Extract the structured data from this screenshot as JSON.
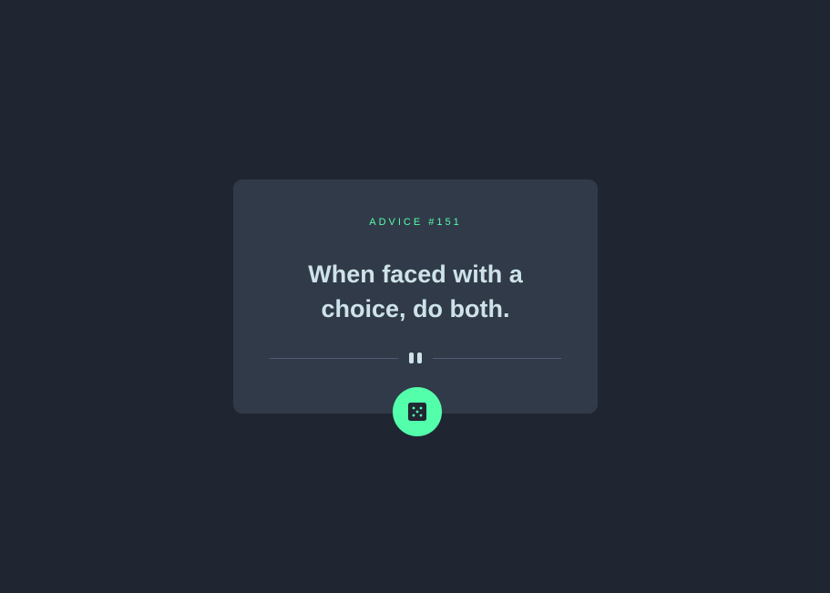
{
  "advice": {
    "id_label": "ADVICE #151",
    "quote": "When faced with a choice, do both."
  },
  "colors": {
    "background": "#1f2632",
    "card": "#313a48",
    "accent": "#53ffaa",
    "text": "#cee3e9",
    "divider": "#4f5d74"
  },
  "icons": {
    "divider": "pause-icon",
    "button": "dice-icon"
  }
}
